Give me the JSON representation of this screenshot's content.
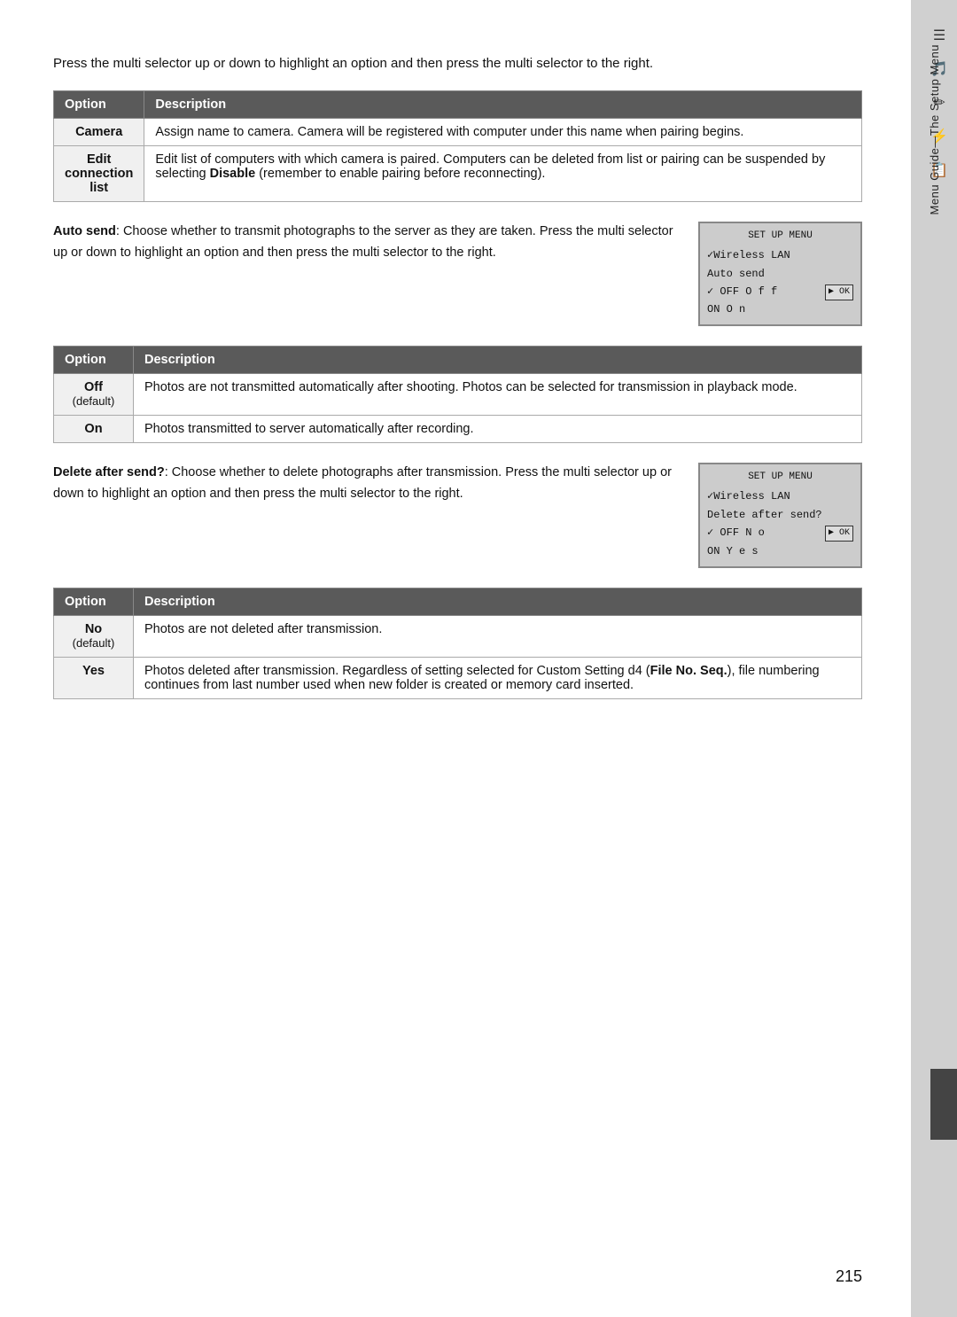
{
  "intro": {
    "text": "Press the multi selector up or down to highlight an option and then press the multi selector to the right."
  },
  "table1": {
    "headers": [
      "Option",
      "Description"
    ],
    "rows": [
      {
        "option": "Camera",
        "description": "Assign name to camera.  Camera will be registered with computer under this name when pairing begins."
      },
      {
        "option": "Edit\nconnection\nlist",
        "description": "Edit list of computers with which camera is paired.  Computers can be deleted from list or pairing can be suspended by selecting Disable (remember to enable pairing before reconnecting)."
      }
    ]
  },
  "autosend": {
    "label": "Auto send",
    "text": ": Choose whether to transmit photographs to the server as they are taken.  Press the multi selector up or down to highlight an option and then press the multi selector to the right.",
    "lcd": {
      "title": "SET UP MENU",
      "subtitle": "✓Wireless LAN",
      "item": "Auto send",
      "row_off": "✓ OFF  O f f",
      "row_on": "ON  O n"
    }
  },
  "table2": {
    "headers": [
      "Option",
      "Description"
    ],
    "rows": [
      {
        "option": "Off\n(default)",
        "description": "Photos are not transmitted automatically after shooting.  Photos can be selected for transmission in playback mode."
      },
      {
        "option": "On",
        "description": "Photos transmitted to server automatically after recording."
      }
    ]
  },
  "deleteafter": {
    "label": "Delete after send?",
    "text": ": Choose whether to delete photographs after transmission.  Press the multi selector up or down to highlight an option and then press the multi selector to the right.",
    "lcd": {
      "title": "SET UP MENU",
      "subtitle": "✓Wireless LAN",
      "item": "Delete after send?",
      "row_off": "✓ OFF  N o",
      "row_on": "ON  Y e s"
    }
  },
  "table3": {
    "headers": [
      "Option",
      "Description"
    ],
    "rows": [
      {
        "option": "No\n(default)",
        "description": "Photos are not deleted after transmission."
      },
      {
        "option": "Yes",
        "description": "Photos deleted after transmission.  Regardless of setting selected for Custom Setting d4 (File No. Seq.), file numbering continues from last number used when new folder is created or memory card inserted."
      }
    ]
  },
  "sidebar": {
    "tab_text": "Menu Guide—The Setup Menu",
    "icons": [
      "📷",
      "🔊",
      "✏️",
      "🔋",
      "📋"
    ]
  },
  "page_number": "215"
}
